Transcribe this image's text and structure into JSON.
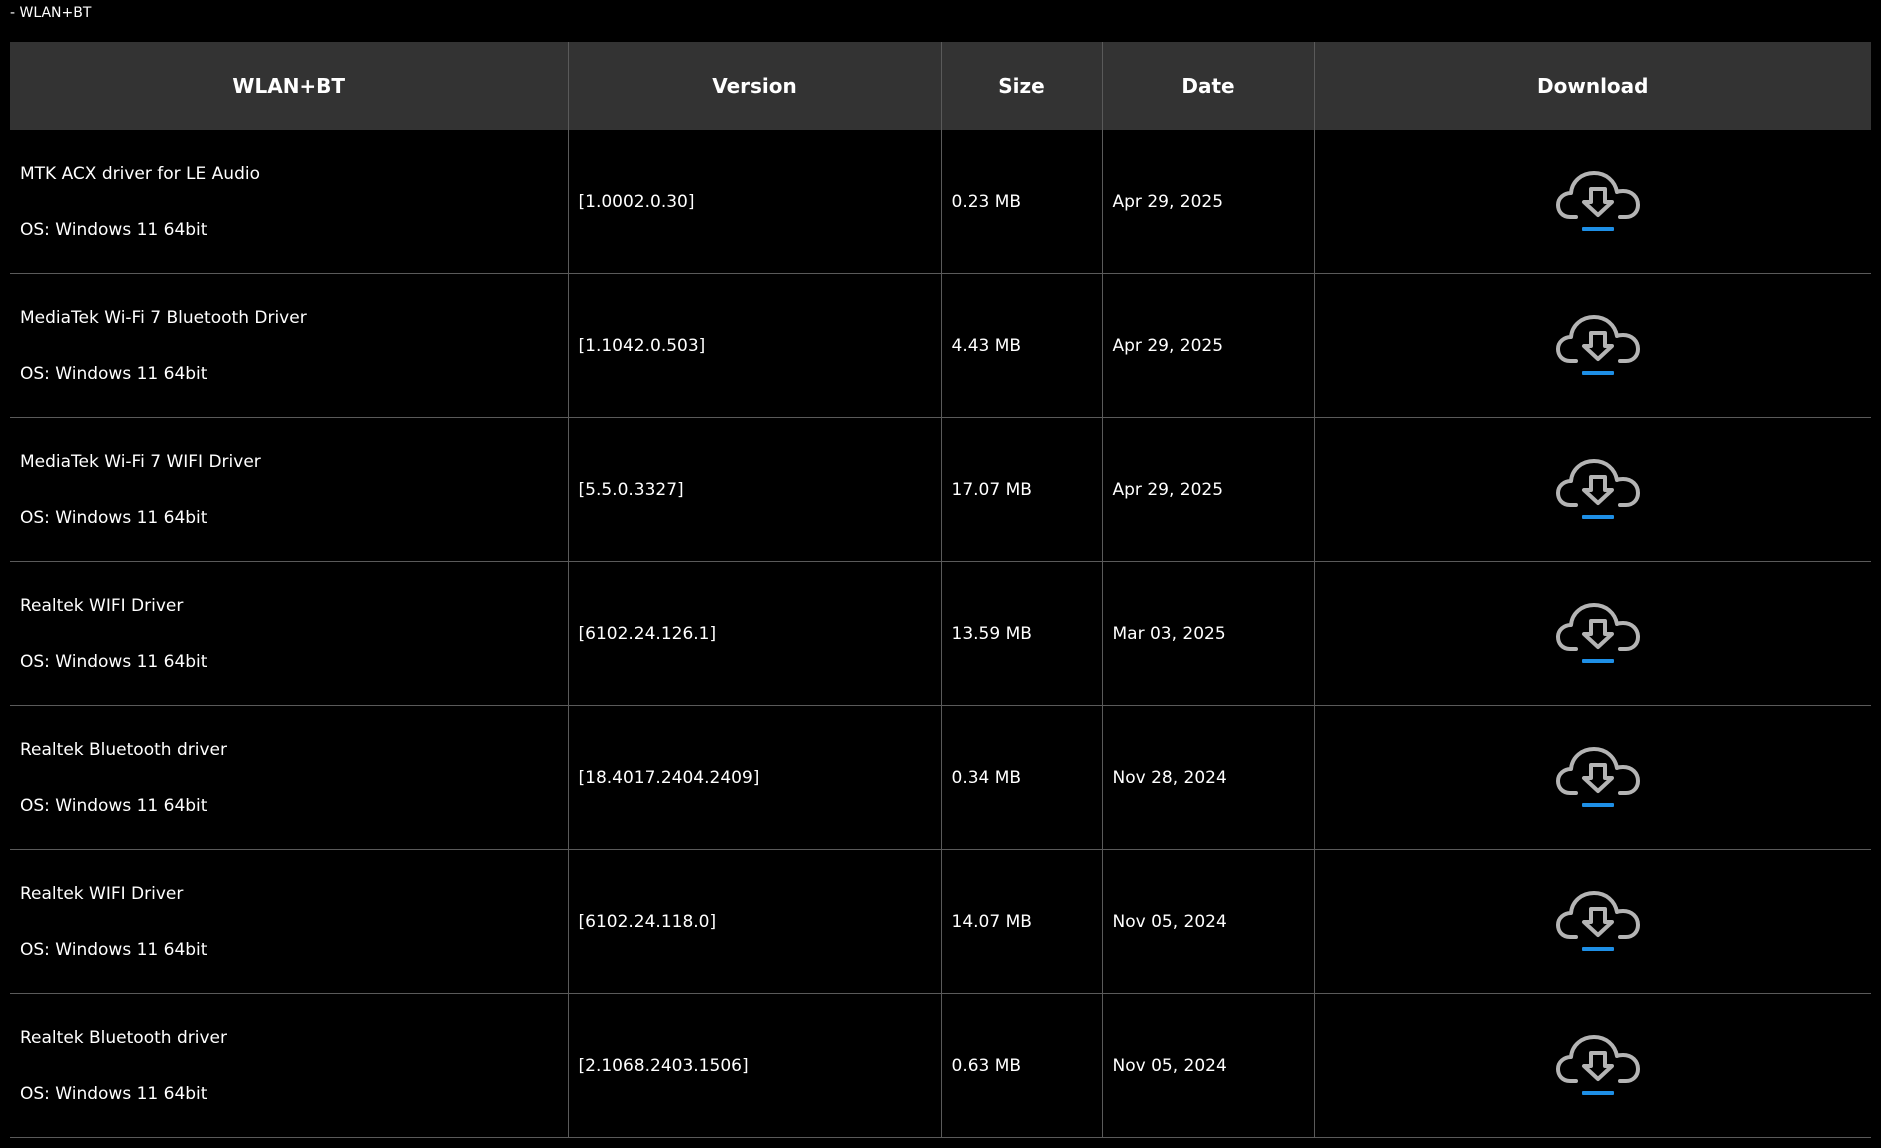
{
  "breadcrumb": "- WLAN+BT",
  "table": {
    "headers": {
      "name": "WLAN+BT",
      "version": "Version",
      "size": "Size",
      "date": "Date",
      "download": "Download"
    },
    "rows": [
      {
        "name": "MTK ACX driver for LE Audio",
        "os": "OS: Windows 11 64bit",
        "version": "[1.0002.0.30]",
        "size": "0.23 MB",
        "date": "Apr 29, 2025"
      },
      {
        "name": "MediaTek Wi-Fi 7 Bluetooth Driver",
        "os": "OS: Windows 11 64bit",
        "version": "[1.1042.0.503]",
        "size": "4.43 MB",
        "date": "Apr 29, 2025"
      },
      {
        "name": "MediaTek Wi-Fi 7 WIFI Driver",
        "os": "OS: Windows 11 64bit",
        "version": "[5.5.0.3327]",
        "size": "17.07 MB",
        "date": "Apr 29, 2025"
      },
      {
        "name": "Realtek WIFI Driver",
        "os": "OS: Windows 11 64bit",
        "version": "[6102.24.126.1]",
        "size": "13.59 MB",
        "date": "Mar 03, 2025"
      },
      {
        "name": "Realtek Bluetooth driver",
        "os": "OS: Windows 11 64bit",
        "version": "[18.4017.2404.2409]",
        "size": "0.34 MB",
        "date": "Nov 28, 2024"
      },
      {
        "name": "Realtek WIFI Driver",
        "os": "OS: Windows 11 64bit",
        "version": "[6102.24.118.0]",
        "size": "14.07 MB",
        "date": "Nov 05, 2024"
      },
      {
        "name": "Realtek Bluetooth driver",
        "os": "OS: Windows 11 64bit",
        "version": "[2.1068.2403.1506]",
        "size": "0.63 MB",
        "date": "Nov 05, 2024"
      }
    ],
    "download_icon": "cloud-download-icon"
  },
  "colors": {
    "background": "#000000",
    "header_bg": "#333333",
    "border": "#5a5a5a",
    "icon_gray": "#b4b4b4",
    "accent_blue": "#1e8fe6"
  }
}
